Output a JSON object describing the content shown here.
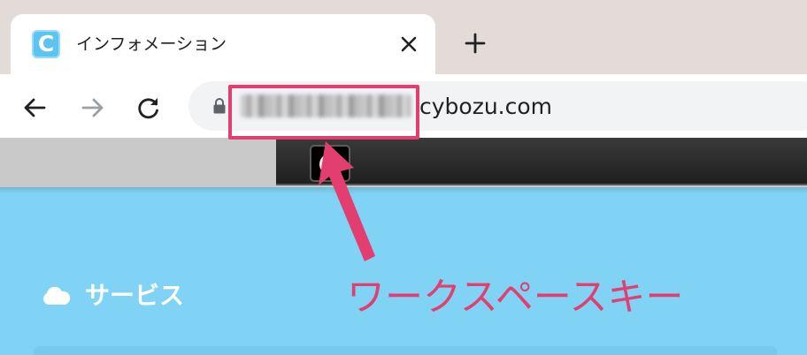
{
  "browser": {
    "tab": {
      "favicon_letter": "C",
      "title": "インフォメーション"
    },
    "address_bar": {
      "domain": "cybozu.com"
    }
  },
  "page": {
    "section": {
      "label": "サービス"
    }
  },
  "annotation": {
    "label": "ワークスペースキー",
    "color": "#e23e6f"
  },
  "colors": {
    "page_background": "#80d3f4",
    "tabstrip": "#e2dbd8",
    "header": "#2a2a2a",
    "favicon": "#5bc4f1"
  }
}
